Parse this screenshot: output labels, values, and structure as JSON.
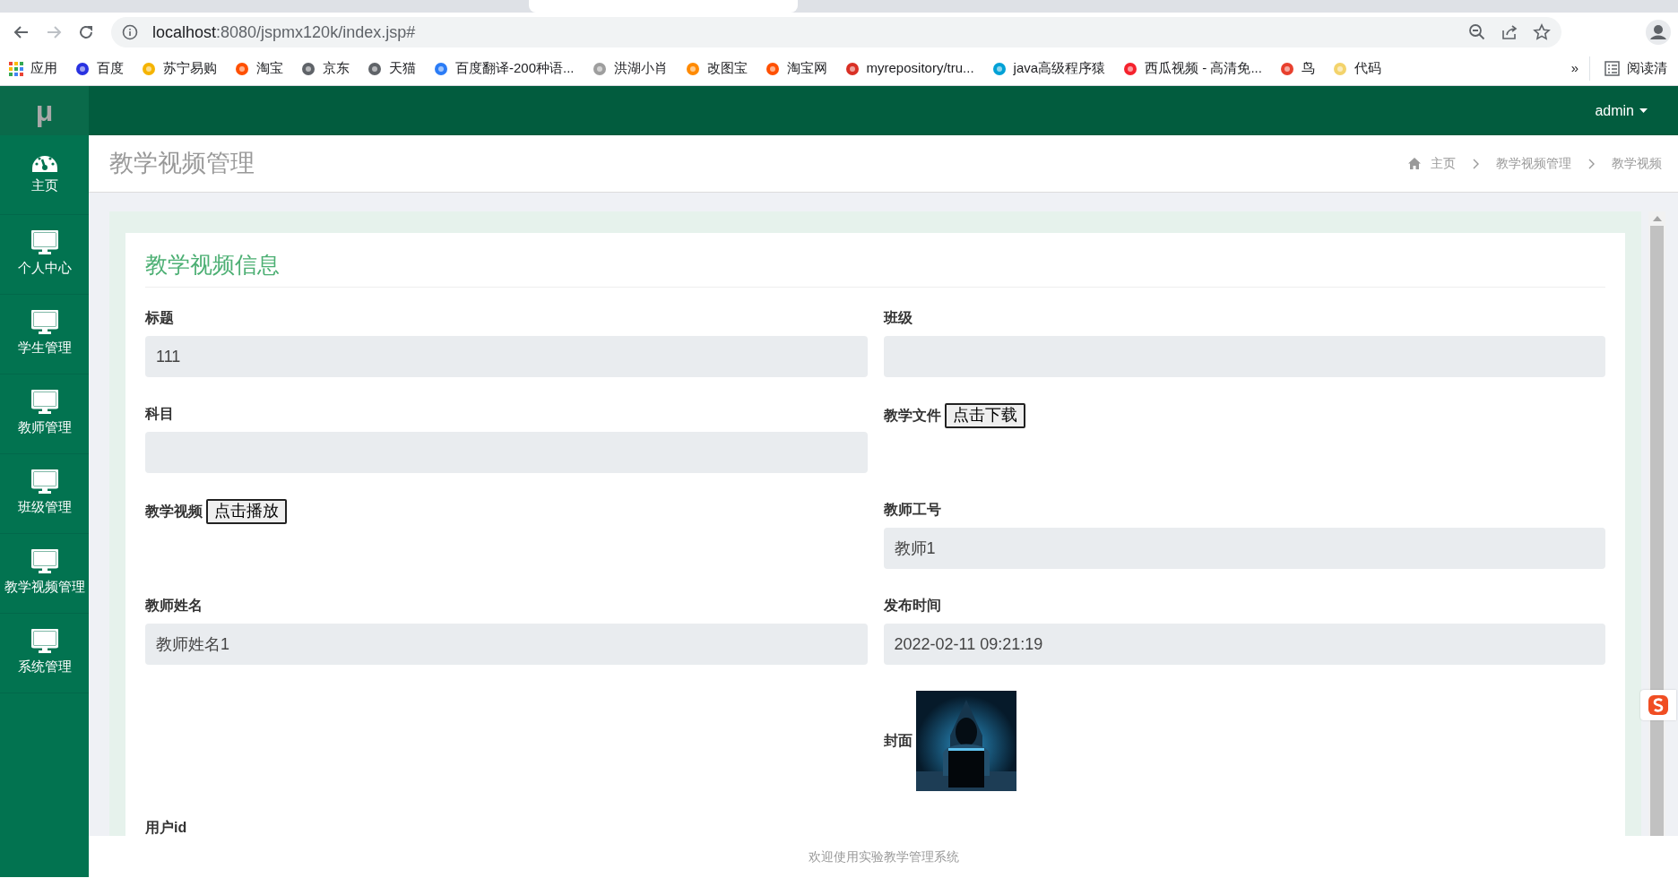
{
  "browser": {
    "url_host": "localhost",
    "url_rest": ":8080/jspmx120k/index.jsp#",
    "bookmarks": [
      {
        "label": "应用",
        "kind": "apps"
      },
      {
        "label": "百度",
        "color": "#2932e1"
      },
      {
        "label": "苏宁易购",
        "color": "#f5b400"
      },
      {
        "label": "淘宝",
        "color": "#ff5000"
      },
      {
        "label": "京东",
        "color": "#5f6368"
      },
      {
        "label": "天猫",
        "color": "#5f6368"
      },
      {
        "label": "百度翻译-200种语...",
        "color": "#2b7cf6"
      },
      {
        "label": "洪湖小肖",
        "color": "#9e9e9e"
      },
      {
        "label": "改图宝",
        "color": "#ff8a00"
      },
      {
        "label": "淘宝网",
        "color": "#ff5000"
      },
      {
        "label": "myrepository/tru...",
        "color": "#d93025"
      },
      {
        "label": "java高级程序猿",
        "color": "#00a1d6"
      },
      {
        "label": "西瓜视频 - 高清免...",
        "color": "#f5222d"
      },
      {
        "label": "鸟",
        "color": "#e8402e"
      },
      {
        "label": "代码",
        "color": "#f3d36b"
      }
    ],
    "more": "»",
    "reading_list": "阅读清"
  },
  "app": {
    "logo": "μ",
    "user": "admin",
    "sidebar": [
      {
        "label": "主页",
        "kind": "home"
      },
      {
        "label": "个人中心",
        "kind": "menu"
      },
      {
        "label": "学生管理",
        "kind": "menu"
      },
      {
        "label": "教师管理",
        "kind": "menu"
      },
      {
        "label": "班级管理",
        "kind": "menu"
      },
      {
        "label": "教学视频管理",
        "kind": "menu"
      },
      {
        "label": "系统管理",
        "kind": "menu"
      }
    ],
    "page_title": "教学视频管理",
    "breadcrumb": [
      "主页",
      "教学视频管理",
      "教学视频"
    ],
    "card_title": "教学视频信息",
    "form_rows": [
      {
        "left": {
          "kind": "input",
          "label": "标题",
          "value": "111"
        },
        "right": {
          "kind": "input",
          "label": "班级"
        }
      },
      {
        "left": {
          "kind": "input",
          "label": "科目"
        },
        "right": {
          "kind": "button",
          "label": "教学文件",
          "button": "点击下载"
        }
      },
      {
        "left": {
          "kind": "button",
          "label": "教学视频",
          "button": "点击播放"
        },
        "right": {
          "kind": "input",
          "label": "教师工号",
          "value": "教师1"
        }
      },
      {
        "left": {
          "kind": "input",
          "label": "教师姓名",
          "value": "教师姓名1"
        },
        "right": {
          "kind": "input",
          "label": "发布时间",
          "value": "2022-02-11 09:21:19"
        }
      },
      {
        "right": {
          "label": "封面"
        }
      },
      {
        "left": {
          "kind": "label",
          "label": "用户id"
        }
      }
    ],
    "footer": "欢迎使用实验教学管理系统"
  }
}
